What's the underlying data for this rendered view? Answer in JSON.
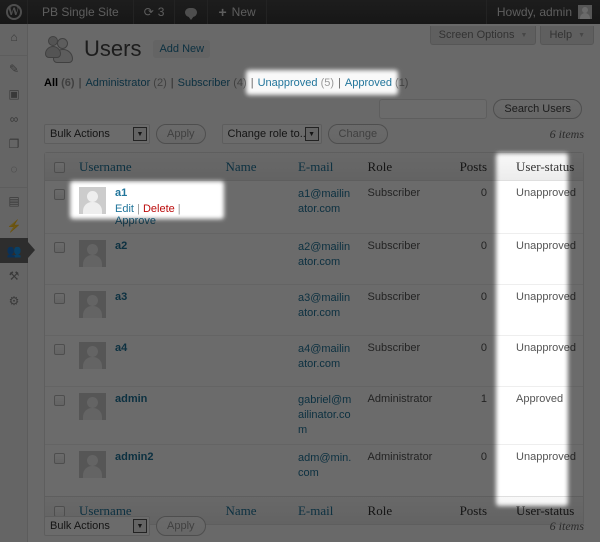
{
  "adminbar": {
    "site_name": "PB Single Site",
    "updates_count": "3",
    "new_label": "New",
    "howdy": "Howdy, admin"
  },
  "sidebar": {
    "items": [
      {
        "icon": "dashboard-icon",
        "glyph": "⌂"
      },
      {
        "icon": "posts-pin-icon",
        "glyph": "✎"
      },
      {
        "icon": "media-icon",
        "glyph": "▣"
      },
      {
        "icon": "links-icon",
        "glyph": "∞"
      },
      {
        "icon": "pages-icon",
        "glyph": "❐"
      },
      {
        "icon": "comments-icon",
        "glyph": "◌"
      },
      {
        "icon": "appearance-icon",
        "glyph": "▤"
      },
      {
        "icon": "plugins-icon",
        "glyph": "⚡"
      },
      {
        "icon": "users-icon",
        "glyph": "👥",
        "current": true
      },
      {
        "icon": "tools-icon",
        "glyph": "⚒"
      },
      {
        "icon": "settings-icon",
        "glyph": "⚙"
      }
    ]
  },
  "screen_meta": {
    "screen_options": "Screen Options",
    "help": "Help"
  },
  "page": {
    "title": "Users",
    "add_new": "Add New"
  },
  "filters": [
    {
      "label": "All",
      "count": "(6)",
      "current": true
    },
    {
      "label": "Administrator",
      "count": "(2)"
    },
    {
      "label": "Subscriber",
      "count": "(4)"
    },
    {
      "label": "Unapproved",
      "count": "(5)"
    },
    {
      "label": "Approved",
      "count": "(1)"
    }
  ],
  "search": {
    "value": "",
    "button": "Search Users"
  },
  "tablenav": {
    "bulk_actions": "Bulk Actions",
    "apply": "Apply",
    "change_role": "Change role to...",
    "change": "Change",
    "items_count": "6 items"
  },
  "table": {
    "columns": [
      "Username",
      "Name",
      "E-mail",
      "Role",
      "Posts",
      "User-status"
    ],
    "rows": [
      {
        "username": "a1",
        "name": "",
        "email": "a1@mailinator.com",
        "role": "Subscriber",
        "posts": "0",
        "status": "Unapproved",
        "actions": {
          "edit": "Edit",
          "delete": "Delete",
          "approve": "Approve"
        }
      },
      {
        "username": "a2",
        "name": "",
        "email": "a2@mailinator.com",
        "role": "Subscriber",
        "posts": "0",
        "status": "Unapproved"
      },
      {
        "username": "a3",
        "name": "",
        "email": "a3@mailinator.com",
        "role": "Subscriber",
        "posts": "0",
        "status": "Unapproved"
      },
      {
        "username": "a4",
        "name": "",
        "email": "a4@mailinator.com",
        "role": "Subscriber",
        "posts": "0",
        "status": "Unapproved"
      },
      {
        "username": "admin",
        "name": "",
        "email": "gabriel@mailinator.com",
        "role": "Administrator",
        "posts": "1",
        "status": "Approved"
      },
      {
        "username": "admin2",
        "name": "",
        "email": "adm@min.com",
        "role": "Administrator",
        "posts": "0",
        "status": "Unapproved"
      }
    ]
  },
  "colors": {
    "link": "#21759b",
    "delete": "#bc0b0b",
    "adminbar": "#464646",
    "overlay": "rgba(0,0,0,0.58)"
  }
}
